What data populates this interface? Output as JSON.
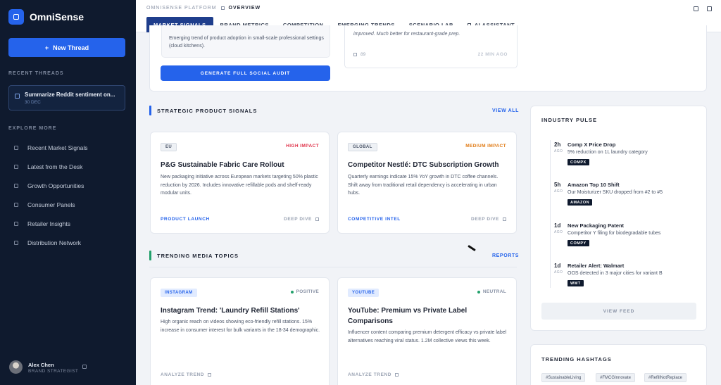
{
  "app": {
    "name": "OmniSense"
  },
  "sidebar": {
    "new_thread_label": "New Thread",
    "recent_heading": "RECENT THREADS",
    "recent_threads": [
      {
        "title": "Summarize Reddit sentiment on...",
        "date": "30 DEC"
      }
    ],
    "explore_heading": "EXPLORE MORE",
    "explore_items": [
      "Recent Market Signals",
      "Latest from the Desk",
      "Growth Opportunities",
      "Consumer Panels",
      "Retailer Insights",
      "Distribution Network"
    ],
    "user": {
      "name": "Alex Chen",
      "role": "BRAND STRATEGIST"
    }
  },
  "header": {
    "platform": "OMNISENSE PLATFORM",
    "page": "OVERVIEW",
    "tabs": [
      "MARKET SIGNALS",
      "BRAND METRICS",
      "COMPETITION",
      "EMERGING TRENDS",
      "SCENARIO LAB",
      "AI ASSISTANT"
    ],
    "active_tab": "MARKET SIGNALS"
  },
  "top_cards": {
    "left_text": "Emerging trend of product adoption in small-scale professional settings (cloud kitchens).",
    "audit_button": "GENERATE FULL SOCIAL AUDIT",
    "right_text": "improved. Much better for restaurant-grade prep.",
    "right_count": "89",
    "right_time": "22 MIN AGO"
  },
  "strategic": {
    "heading": "STRATEGIC PRODUCT SIGNALS",
    "link": "VIEW ALL",
    "accent": "#2563eb",
    "cards": [
      {
        "tag": "EU",
        "impact": "HIGH IMPACT",
        "impact_color": "#e0344b",
        "title": "P&G Sustainable Fabric Care Rollout",
        "body": "New packaging initiative across European markets targeting 50% plastic reduction by 2026. Includes innovative refillable pods and shelf-ready modular units.",
        "action": "PRODUCT LAUNCH",
        "deep": "DEEP DIVE"
      },
      {
        "tag": "GLOBAL",
        "impact": "MEDIUM IMPACT",
        "impact_color": "#e07b16",
        "title": "Competitor Nestlé: DTC Subscription Growth",
        "body": "Quarterly earnings indicate 15% YoY growth in DTC coffee channels. Shift away from traditional retail dependency is accelerating in urban hubs.",
        "action": "COMPETITIVE INTEL",
        "deep": "DEEP DIVE"
      }
    ]
  },
  "media": {
    "heading": "TRENDING MEDIA TOPICS",
    "link": "REPORTS",
    "accent": "#22a06b",
    "cards": [
      {
        "tag": "INSTAGRAM",
        "sentiment": "POSITIVE",
        "sentiment_color": "#22a06b",
        "title": "Instagram Trend: 'Laundry Refill Stations'",
        "body": "High organic reach on videos showing eco-friendly refill stations. 15% increase in consumer interest for bulk variants in the 18-34 demographic.",
        "action": "ANALYZE TREND"
      },
      {
        "tag": "YOUTUBE",
        "sentiment": "NEUTRAL",
        "sentiment_color": "#22a06b",
        "title": "YouTube: Premium vs Private Label Comparisons",
        "body": "Influencer content comparing premium detergent efficacy vs private label alternatives reaching viral status. 1.2M collective views this week.",
        "action": "ANALYZE TREND"
      }
    ]
  },
  "pulse": {
    "heading": "INDUSTRY PULSE",
    "ago_label": "AGO",
    "items": [
      {
        "time": "2h",
        "title": "Comp X Price Drop",
        "desc": "5% reduction on 1L laundry category",
        "badge": "COMPX"
      },
      {
        "time": "5h",
        "title": "Amazon Top 10 Shift",
        "desc": "Our Moisturizer SKU dropped from #2 to #5",
        "badge": "AMAZON"
      },
      {
        "time": "1d",
        "title": "New Packaging Patent",
        "desc": "Competitor Y filing for biodegradable tubes",
        "badge": "COMPY"
      },
      {
        "time": "1d",
        "title": "Retailer Alert: Walmart",
        "desc": "OOS detected in 3 major cities for variant B",
        "badge": "WMT"
      }
    ],
    "view_feed": "VIEW FEED"
  },
  "hashtags": {
    "heading": "TRENDING HASHTAGS",
    "tags": [
      "#SustainableLiving",
      "#FMCGInnovate",
      "#RefillNotReplace"
    ]
  }
}
